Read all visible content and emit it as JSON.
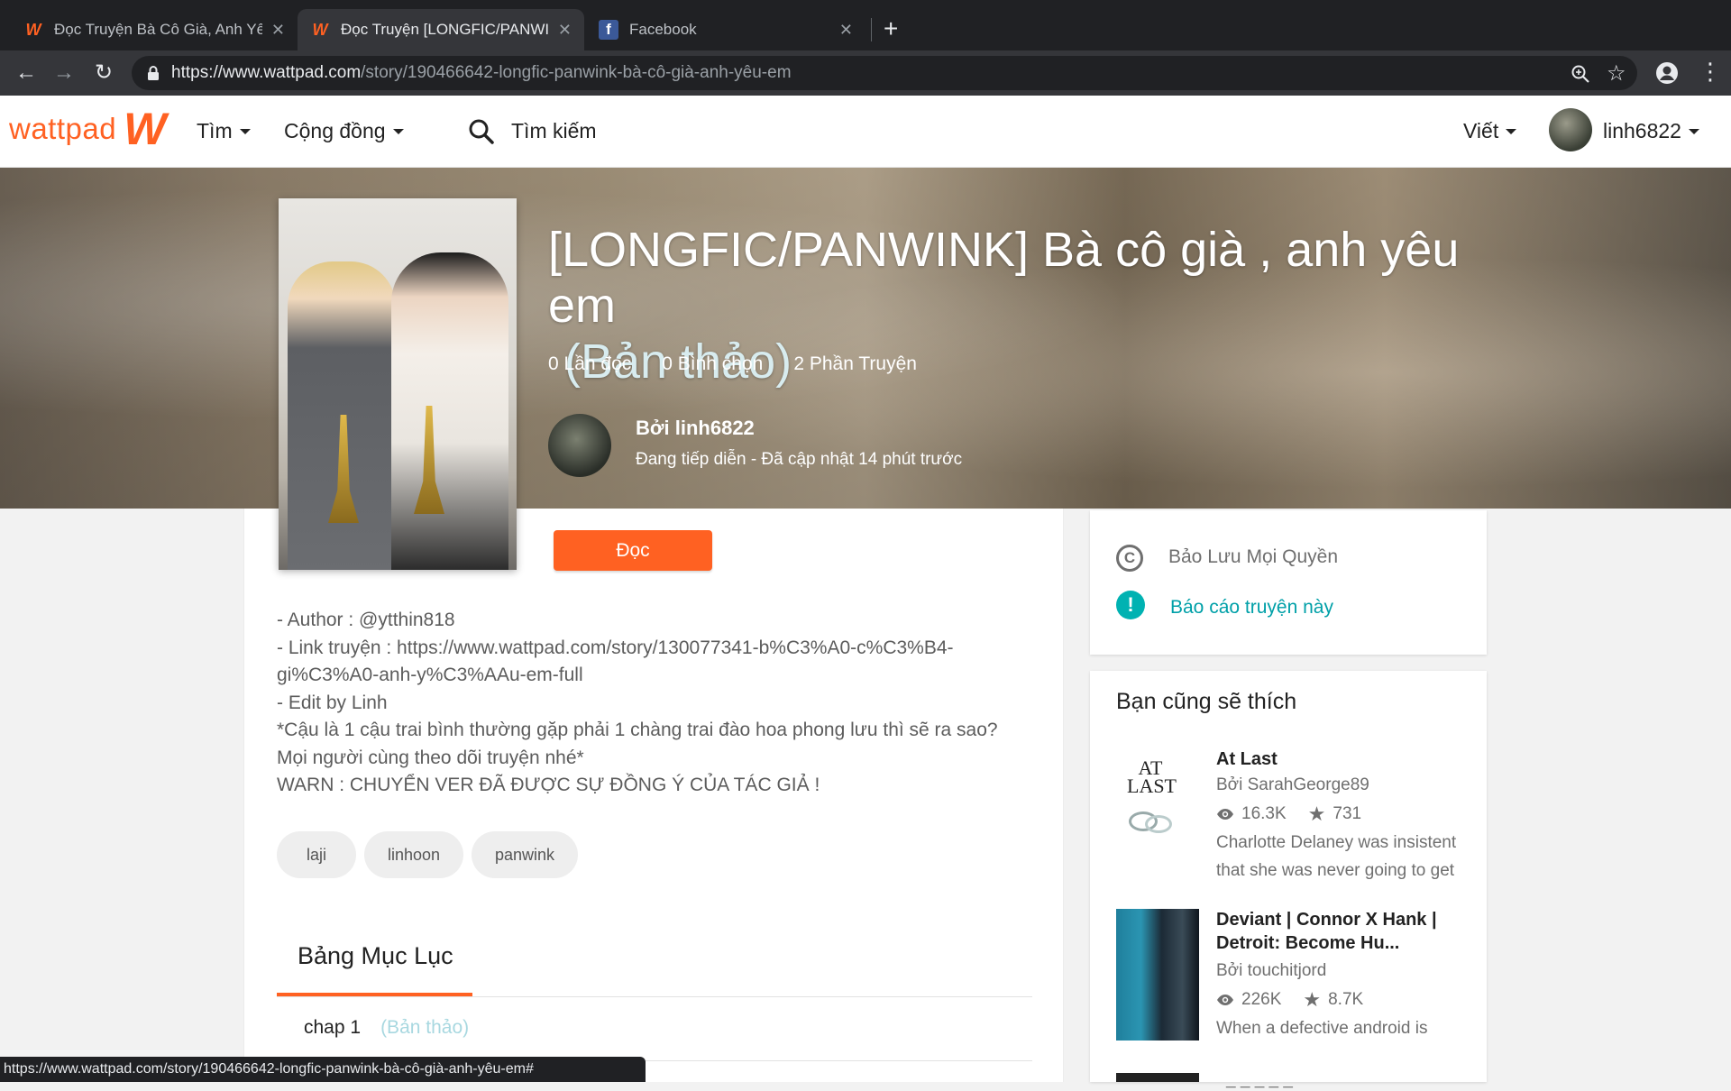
{
  "browser": {
    "tabs": [
      {
        "title": "Đọc Truyện Bà Cô Già, Anh Yêu"
      },
      {
        "title": "Đọc Truyện [LONGFIC/PANWIN"
      },
      {
        "title": "Facebook"
      }
    ],
    "url_host": "https://www.wattpad.com",
    "url_path": "/story/190466642-longfic-panwink-bà-cô-già-anh-yêu-em",
    "status_url": "https://www.wattpad.com/story/190466642-longfic-panwink-bà-cô-già-anh-yêu-em#"
  },
  "header": {
    "logo_text": "wattpad",
    "discover": "Tìm",
    "community": "Cộng đồng",
    "search": "Tìm kiếm",
    "write": "Viết",
    "username": "linh6822"
  },
  "story": {
    "title": "[LONGFIC/PANWINK] Bà cô già , anh yêu em",
    "draft_label": "(Bản thảo)",
    "reads": "0 Lần đọc",
    "votes": "0 Bình chọn",
    "parts": "2 Phần Truyện",
    "author": "Bởi linh6822",
    "status": "Đang tiếp diễn - Đã cập nhật 14 phút trước",
    "read_button": "Đọc",
    "description": "- Author : @ytthin818\n- Link truyện : https://www.wattpad.com/story/130077341-b%C3%A0-c%C3%B4-\ngi%C3%A0-anh-y%C3%AAu-em-full\n- Edit by Linh\n*Cậu là 1 cậu trai bình thường gặp phải 1 chàng trai đào hoa phong lưu thì sẽ ra sao?\nMọi người cùng theo dõi truyện nhé*\nWARN : CHUYỂN VER ĐÃ ĐƯỢC SỰ ĐỒNG Ý CỦA TÁC GIẢ !",
    "tags": [
      "laji",
      "linhoon",
      "panwink"
    ]
  },
  "toc": {
    "title": "Bảng Mục Lục",
    "items": [
      {
        "name": "chap 1",
        "draft": "(Bản thảo)"
      }
    ]
  },
  "sidebar": {
    "rights": "Bảo Lưu Mọi Quyền",
    "report": "Báo cáo truyện này",
    "rec_title": "Bạn cũng sẽ thích",
    "recs": [
      {
        "cover_text": "AT LAST",
        "name": "At Last",
        "by": "Bởi SarahGeorge89",
        "views": "16.3K",
        "votes": "731",
        "desc": "Charlotte Delaney was insistent that she was never going to get"
      },
      {
        "name1": "Deviant | Connor X Hank |",
        "name2": "Detroit: Become Hu...",
        "by": "Bởi touchitjord",
        "views": "226K",
        "votes": "8.7K",
        "desc": "When a defective android is"
      }
    ],
    "teaser": "_ _ _ _ _"
  },
  "colors": {
    "brand": "#ff6122",
    "teal": "#00b2b2"
  }
}
